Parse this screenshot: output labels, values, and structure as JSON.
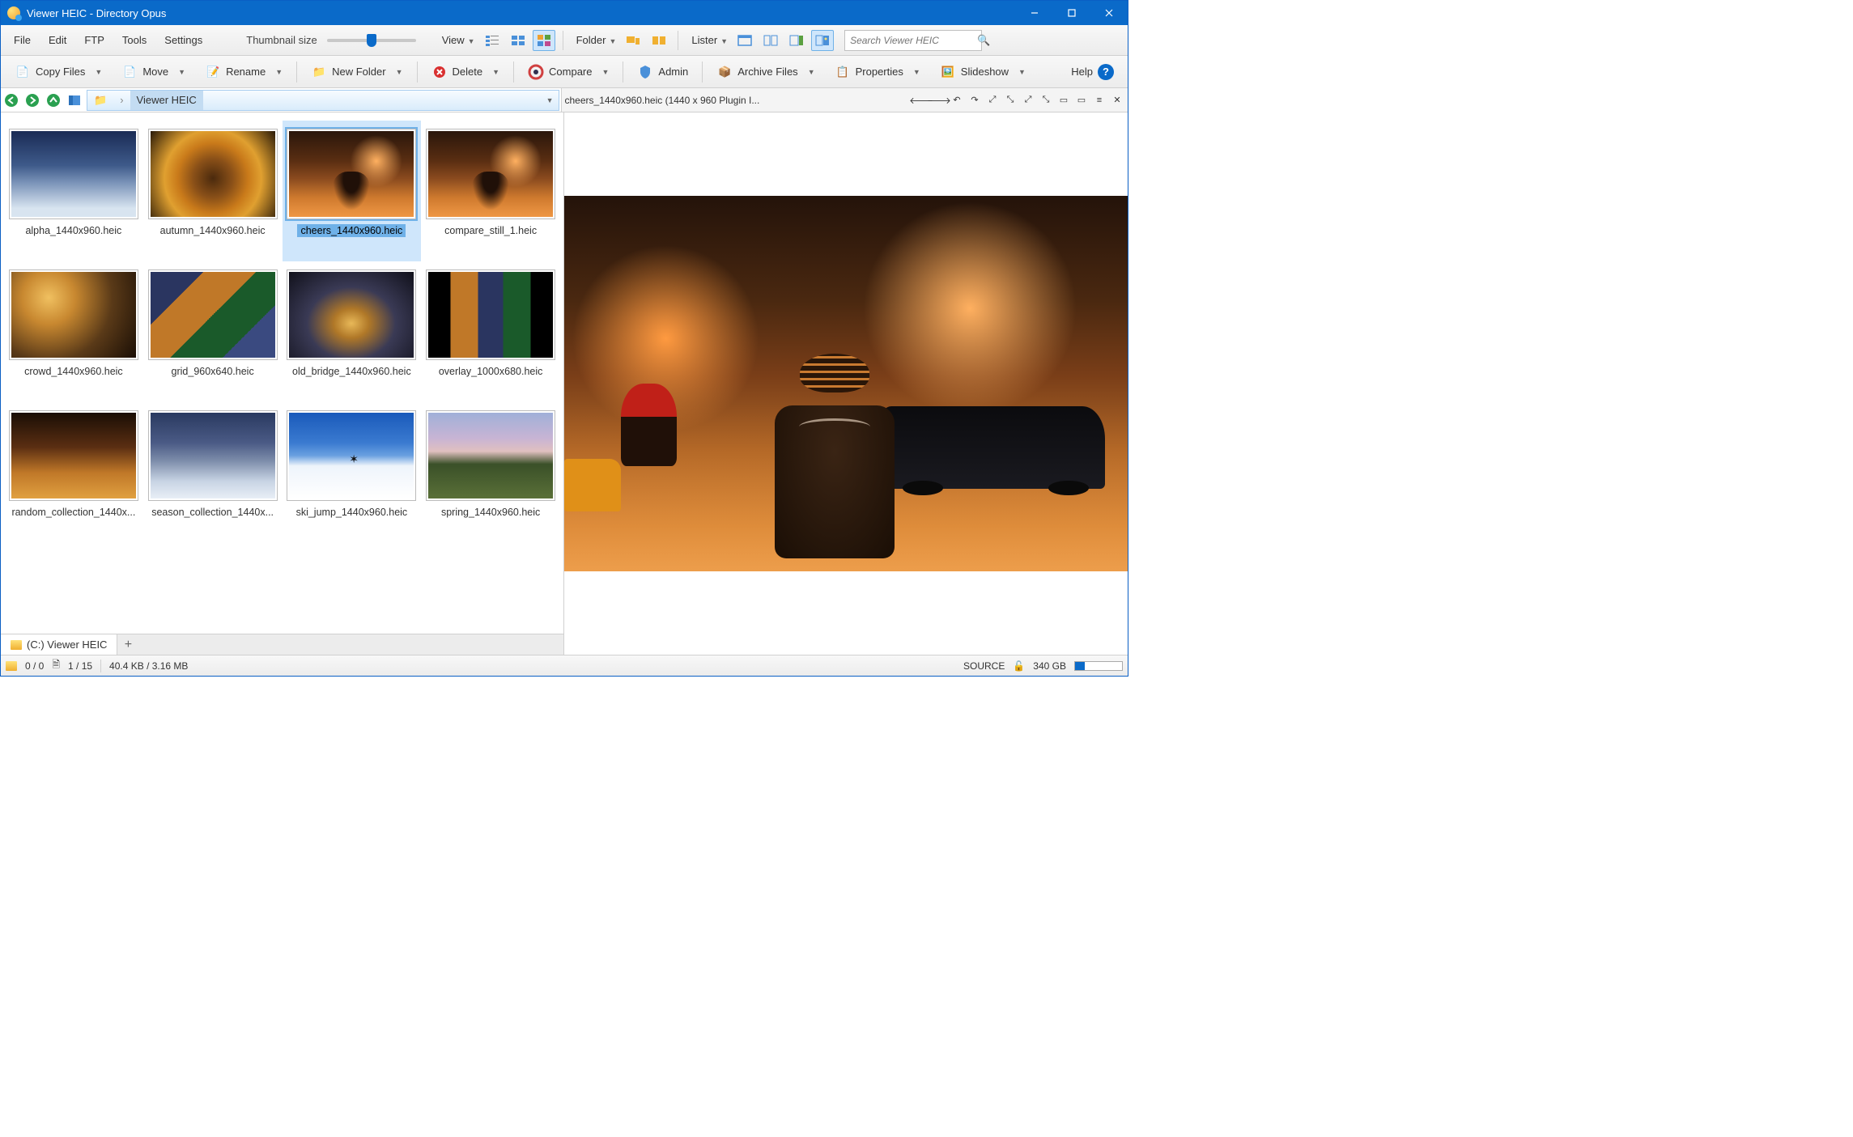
{
  "title": "Viewer HEIC - Directory Opus",
  "menu": {
    "file": "File",
    "edit": "Edit",
    "ftp": "FTP",
    "tools": "Tools",
    "settings": "Settings",
    "thumbsize": "Thumbnail size",
    "view": "View",
    "folder": "Folder",
    "lister": "Lister"
  },
  "search_placeholder": "Search Viewer HEIC",
  "toolbar": {
    "copy": "Copy Files",
    "move": "Move",
    "rename": "Rename",
    "newfolder": "New Folder",
    "delete": "Delete",
    "compare": "Compare",
    "admin": "Admin",
    "archive": "Archive Files",
    "properties": "Properties",
    "slideshow": "Slideshow",
    "help": "Help"
  },
  "breadcrumb": {
    "folder": "Viewer HEIC"
  },
  "viewer_file": "cheers_1440x960.heic (1440 x 960 Plugin I...",
  "files": [
    {
      "name": "alpha_1440x960.heic",
      "cls": "g-winter"
    },
    {
      "name": "autumn_1440x960.heic",
      "cls": "g-autumn"
    },
    {
      "name": "cheers_1440x960.heic",
      "cls": "g-city",
      "selected": true
    },
    {
      "name": "compare_still_1.heic",
      "cls": "g-city"
    },
    {
      "name": "crowd_1440x960.heic",
      "cls": "g-crowd"
    },
    {
      "name": "grid_960x640.heic",
      "cls": "g-grid"
    },
    {
      "name": "old_bridge_1440x960.heic",
      "cls": "g-bridge"
    },
    {
      "name": "overlay_1000x680.heic",
      "cls": "g-overlay"
    },
    {
      "name": "random_collection_1440x...",
      "cls": "g-random"
    },
    {
      "name": "season_collection_1440x...",
      "cls": "g-season"
    },
    {
      "name": "ski_jump_1440x960.heic",
      "cls": "g-ski"
    },
    {
      "name": "spring_1440x960.heic",
      "cls": "g-spring"
    }
  ],
  "tab": "(C:) Viewer HEIC",
  "status": {
    "sel": "0 / 0",
    "total": "1 / 15",
    "size": "40.4 KB / 3.16 MB",
    "source": "SOURCE",
    "disk": "340 GB"
  }
}
